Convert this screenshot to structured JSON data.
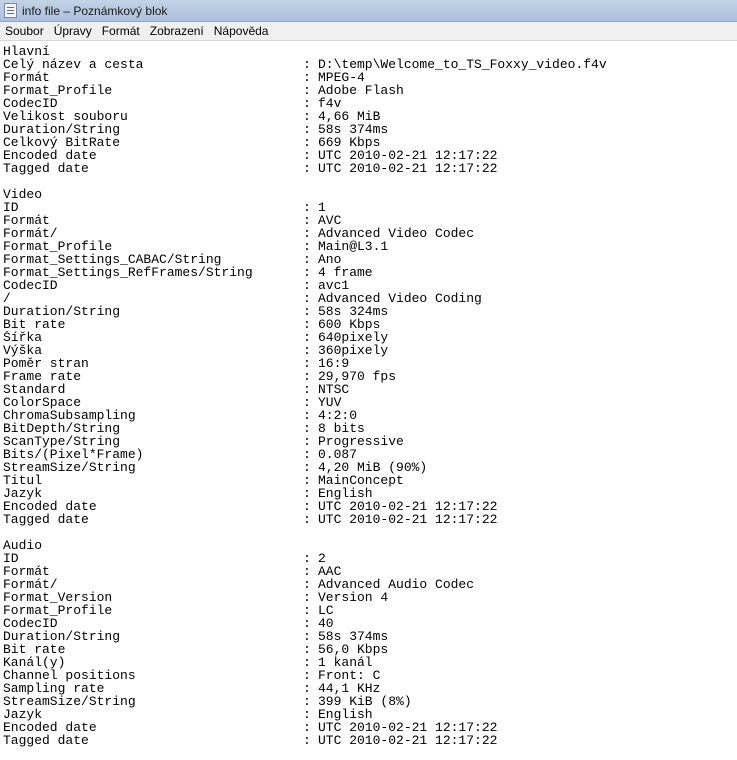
{
  "window": {
    "title": "info file – Poznámkový blok"
  },
  "menu": [
    "Soubor",
    "Úpravy",
    "Formát",
    "Zobrazení",
    "Nápověda"
  ],
  "sections": [
    {
      "name": "Hlavní",
      "rows": [
        [
          "Celý název a cesta",
          "D:\\temp\\Welcome_to_TS_Foxxy_video.f4v"
        ],
        [
          "Formát",
          "MPEG-4"
        ],
        [
          "Format_Profile",
          "Adobe Flash"
        ],
        [
          "CodecID",
          "f4v"
        ],
        [
          "Velikost souboru",
          "4,66 MiB"
        ],
        [
          "Duration/String",
          "58s 374ms"
        ],
        [
          "Celkový BitRate",
          "669 Kbps"
        ],
        [
          "Encoded date",
          "UTC 2010-02-21 12:17:22"
        ],
        [
          "Tagged date",
          "UTC 2010-02-21 12:17:22"
        ]
      ]
    },
    {
      "name": "Video",
      "rows": [
        [
          "ID",
          "1"
        ],
        [
          "Formát",
          "AVC"
        ],
        [
          "Formát/",
          "Advanced Video Codec"
        ],
        [
          "Format_Profile",
          "Main@L3.1"
        ],
        [
          "Format_Settings_CABAC/String",
          "Ano"
        ],
        [
          "Format_Settings_RefFrames/String",
          "4 frame"
        ],
        [
          "CodecID",
          "avc1"
        ],
        [
          "/",
          "Advanced Video Coding"
        ],
        [
          "Duration/String",
          "58s 324ms"
        ],
        [
          "Bit rate",
          "600 Kbps"
        ],
        [
          "Šířka",
          "640pixely"
        ],
        [
          "Výška",
          "360pixely"
        ],
        [
          "Poměr stran",
          "16:9"
        ],
        [
          "Frame rate",
          "29,970 fps"
        ],
        [
          "Standard",
          "NTSC"
        ],
        [
          "ColorSpace",
          "YUV"
        ],
        [
          "ChromaSubsampling",
          "4:2:0"
        ],
        [
          "BitDepth/String",
          "8 bits"
        ],
        [
          "ScanType/String",
          "Progressive"
        ],
        [
          "Bits/(Pixel*Frame)",
          "0.087"
        ],
        [
          "StreamSize/String",
          "4,20 MiB (90%)"
        ],
        [
          "Titul",
          "MainConcept"
        ],
        [
          "Jazyk",
          "English"
        ],
        [
          "Encoded date",
          "UTC 2010-02-21 12:17:22"
        ],
        [
          "Tagged date",
          "UTC 2010-02-21 12:17:22"
        ]
      ]
    },
    {
      "name": "Audio",
      "rows": [
        [
          "ID",
          "2"
        ],
        [
          "Formát",
          "AAC"
        ],
        [
          "Formát/",
          "Advanced Audio Codec"
        ],
        [
          "Format_Version",
          "Version 4"
        ],
        [
          "Format_Profile",
          "LC"
        ],
        [
          "CodecID",
          "40"
        ],
        [
          "Duration/String",
          "58s 374ms"
        ],
        [
          "Bit rate",
          "56,0 Kbps"
        ],
        [
          "Kanál(y)",
          "1 kanál"
        ],
        [
          "Channel positions",
          "Front: C"
        ],
        [
          "Sampling rate",
          "44,1 KHz"
        ],
        [
          "StreamSize/String",
          "399 KiB (8%)"
        ],
        [
          "Jazyk",
          "English"
        ],
        [
          "Encoded date",
          "UTC 2010-02-21 12:17:22"
        ],
        [
          "Tagged date",
          "UTC 2010-02-21 12:17:22"
        ]
      ]
    }
  ]
}
